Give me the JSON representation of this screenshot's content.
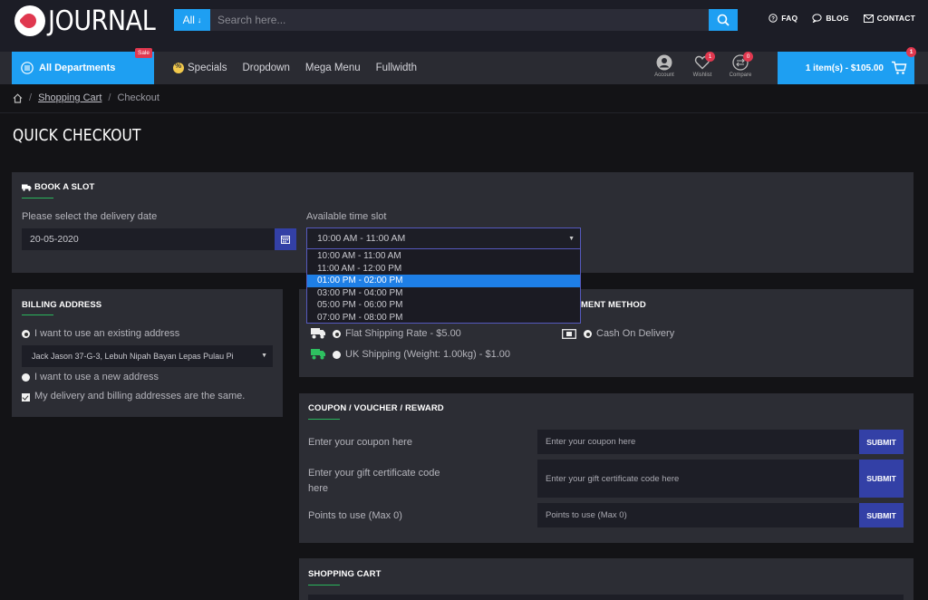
{
  "header": {
    "logo_text": "JOURNAL",
    "search": {
      "category": "All",
      "placeholder": "Search here..."
    },
    "links": [
      {
        "label": "FAQ",
        "icon": "help-circle-icon"
      },
      {
        "label": "BLOG",
        "icon": "chat-bubble-icon"
      },
      {
        "label": "CONTACT",
        "icon": "mail-icon"
      }
    ]
  },
  "nav": {
    "all_departments": "All Departments",
    "sale_badge": "Sale",
    "menu": [
      "Specials",
      "Dropdown",
      "Mega Menu",
      "Fullwidth"
    ],
    "account_label": "Account",
    "wishlist_label": "Wishlist",
    "wishlist_count": "1",
    "compare_label": "Compare",
    "compare_count": "0",
    "cart_label": "1 item(s) - $105.00",
    "cart_count": "1"
  },
  "breadcrumb": {
    "cart": "Shopping Cart",
    "current": "Checkout"
  },
  "page_title": "QUICK CHECKOUT",
  "slot": {
    "title": "BOOK A SLOT",
    "date_label": "Please select the delivery date",
    "date_value": "20-05-2020",
    "time_label": "Available time slot",
    "time_value": "10:00 AM - 11:00 AM",
    "options": [
      "10:00 AM - 11:00 AM",
      "11:00 AM - 12:00 PM",
      "01:00 PM - 02:00 PM",
      "03:00 PM - 04:00 PM",
      "05:00 PM - 06:00 PM",
      "07:00 PM - 08:00 PM"
    ],
    "highlighted_option": "01:00 PM - 02:00 PM"
  },
  "billing": {
    "title": "BILLING ADDRESS",
    "existing": "I want to use an existing address",
    "address": "Jack Jason 37-G-3, Lebuh Nipah Bayan Lepas Pulau Pi",
    "new": "I want to use a new address",
    "same": "My delivery and billing addresses are the same."
  },
  "shipping": {
    "options": [
      "Flat Shipping Rate - $5.00",
      "UK Shipping (Weight: 1.00kg) - $1.00"
    ]
  },
  "payment": {
    "title_visible": "MENT METHOD",
    "option": "Cash On Delivery"
  },
  "coupon": {
    "title": "COUPON / VOUCHER / REWARD",
    "coupon_label": "Enter your coupon here",
    "coupon_placeholder": "Enter your coupon here",
    "gift_label": "Enter your gift certificate code here",
    "gift_placeholder": "Enter your gift certificate code here",
    "points_label": "Points to use (Max 0)",
    "points_placeholder": "Points to use (Max 0)",
    "submit": "SUBMIT"
  },
  "cart_section": {
    "title": "SHOPPING CART"
  },
  "colors": {
    "accent": "#1e9ff2",
    "submit": "#3340a6",
    "badge": "#e0384f",
    "underline": "#29b55c"
  }
}
